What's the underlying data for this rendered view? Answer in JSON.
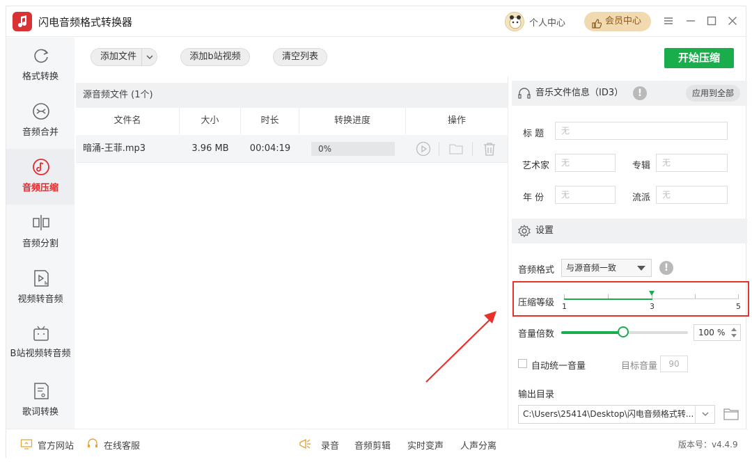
{
  "app": {
    "title": "闪电音频格式转换器"
  },
  "header": {
    "user_center": "个人中心",
    "vip": "会员中心"
  },
  "sidebar": {
    "items": [
      {
        "label": "格式转换",
        "icon": "refresh-icon"
      },
      {
        "label": "音频合并",
        "icon": "merge-icon"
      },
      {
        "label": "音频压缩",
        "icon": "music-note-icon",
        "active": true
      },
      {
        "label": "音频分割",
        "icon": "split-icon"
      },
      {
        "label": "视频转音频",
        "icon": "video-audio-icon"
      },
      {
        "label": "B站视频转音频",
        "icon": "bilibili-tv-icon"
      },
      {
        "label": "歌词转换",
        "icon": "lyrics-file-icon"
      }
    ]
  },
  "toolbar": {
    "add_file": "添加文件",
    "add_bili": "添加b站视频",
    "clear_list": "清空列表",
    "start": "开始压缩"
  },
  "file_list": {
    "header": "源音频文件 (1个)",
    "columns": [
      "文件名",
      "大小",
      "时长",
      "转换进度",
      "操作"
    ],
    "rows": [
      {
        "name": "暗涌-王菲.mp3",
        "size": "3.96 MB",
        "duration": "00:04:19",
        "progress": "0%"
      }
    ]
  },
  "id3": {
    "title": "音乐文件信息（ID3）",
    "apply_all": "应用到全部",
    "title_label": "标  题",
    "artist_label": "艺术家",
    "album_label": "专辑",
    "year_label": "年  份",
    "genre_label": "流派",
    "placeholder": "无"
  },
  "settings": {
    "title": "设置",
    "format_label": "音频格式",
    "format_value": "与源音频一致",
    "compress_label": "压缩等级",
    "compress_min": "1",
    "compress_value": "3",
    "compress_max": "5",
    "volume_label": "音量倍数",
    "volume_value": "100",
    "volume_unit": "%",
    "volume_fraction": 0.49,
    "auto_volume_label": "自动统一音量",
    "target_volume_label": "目标音量",
    "target_volume_value": "90",
    "output_label": "输出目录",
    "output_path": "C:\\Users\\25414\\Desktop\\闪电音频格式转..."
  },
  "footer": {
    "website": "官方网站",
    "support": "在线客服",
    "record": "录音",
    "edit": "音频剪辑",
    "voice_change": "实时变声",
    "vocal_split": "人声分离",
    "version": "版本号：v4.4.9"
  },
  "colors": {
    "accent": "#1aad4b",
    "active": "#e02b2b",
    "highlight": "#e8312a"
  }
}
